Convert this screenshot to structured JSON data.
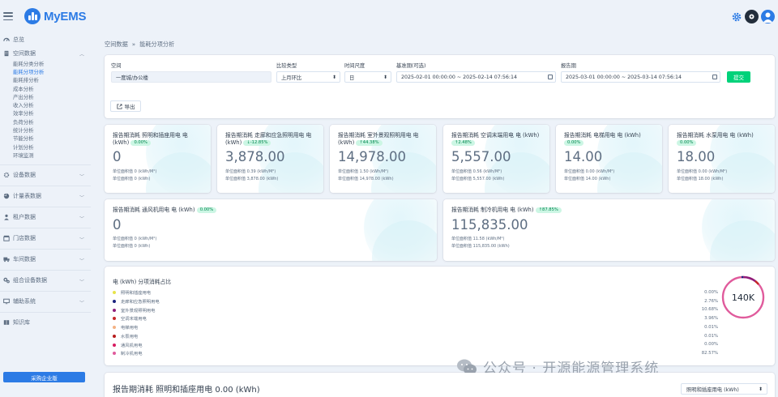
{
  "app": {
    "logo_text": "MyEMS"
  },
  "sidebar": {
    "overview": "总览",
    "space_data": "空间数据",
    "sub_items": [
      "能耗分类分析",
      "能耗分项分析",
      "能耗排分析",
      "成本分析",
      "产出分析",
      "收入分析",
      "效率分析",
      "负荷分析",
      "统计分析",
      "节能分析",
      "计划分析",
      "环境监测"
    ],
    "groups": [
      "设备数据",
      "计量表数据",
      "租户数据",
      "门店数据",
      "车间数据",
      "组合设备数据",
      "辅助系统",
      "知识库"
    ],
    "buy_button": "采购企业版"
  },
  "breadcrumb": {
    "parent": "空间数据",
    "separator": "»",
    "current": "能耗分项分析"
  },
  "filter": {
    "space_label": "空间",
    "space_value": "一度城/办公楼",
    "compare_label": "比较类型",
    "compare_value": "上月环比",
    "period_label": "时间尺度",
    "period_value": "日",
    "base_label": "基准期(可选)",
    "base_value": "2025-02-01 00:00:00 ~ 2025-02-14 07:56:14",
    "report_label": "报告期",
    "report_value": "2025-03-01 00:00:00 ~ 2025-03-14 07:56:14",
    "submit": "提交",
    "export": "导出"
  },
  "metrics_row1": [
    {
      "title": "报告期消耗 照明和插座用电 电 (kWh)",
      "badge": "0.00%",
      "value": "0",
      "sub1": "单位面积值 0 (kWh/M²)",
      "sub2": "单位面积值 0 (kWh)"
    },
    {
      "title": "报告期消耗 走廊和应急照明用电 电 (kWh)",
      "badge": "↓-12.85%",
      "value": "3,878.00",
      "sub1": "单位面积值 0.39 (kWh/M²)",
      "sub2": "单位面积值 3,878.00 (kWh)"
    },
    {
      "title": "报告期消耗 室外景观照明用电 电 (kWh)",
      "badge": "↑44.38%",
      "value": "14,978.00",
      "sub1": "单位面积值 1.50 (kWh/M²)",
      "sub2": "单位面积值 14,978.00 (kWh)"
    },
    {
      "title": "报告期消耗 空调末端用电 电 (kWh)",
      "badge": "↑2.48%",
      "value": "5,557.00",
      "sub1": "单位面积值 0.56 (kWh/M²)",
      "sub2": "单位面积值 5,557.00 (kWh)"
    },
    {
      "title": "报告期消耗 电梯用电 电 (kWh)",
      "badge": "0.00%",
      "value": "14.00",
      "sub1": "单位面积值 0.00 (kWh/M²)",
      "sub2": "单位面积值 14.00 (kWh)"
    },
    {
      "title": "报告期消耗 水泵用电 电 (kWh)",
      "badge": "0.00%",
      "value": "18.00",
      "sub1": "单位面积值 0.00 (kWh/M²)",
      "sub2": "单位面积值 18.00 (kWh)"
    }
  ],
  "metrics_row2": [
    {
      "title": "报告期消耗 通风机用电 电 (kWh)",
      "badge": "0.00%",
      "value": "0",
      "sub1": "单位面积值 0 (kWh/M²)",
      "sub2": "单位面积值 0 (kWh)"
    },
    {
      "title": "报告期消耗 制冷机用电 电 (kWh)",
      "badge": "↑87.85%",
      "value": "115,835.00",
      "sub1": "单位面积值 11.58 (kWh/M²)",
      "sub2": "单位面积值 115,835.00 (kWh)"
    }
  ],
  "pie": {
    "title": "电 (kWh) 分项消耗占比",
    "center_label": "140K",
    "items": [
      {
        "name": "照明和插座用电",
        "color": "#e7e34a",
        "pct": "0.00%"
      },
      {
        "name": "走廊和应急照明用电",
        "color": "#1a237e",
        "pct": "2.76%"
      },
      {
        "name": "室外景观照明用电",
        "color": "#8e1e7a",
        "pct": "10.68%"
      },
      {
        "name": "空调末端用电",
        "color": "#c62828",
        "pct": "3.96%"
      },
      {
        "name": "电梯用电",
        "color": "#f4b183",
        "pct": "0.01%"
      },
      {
        "name": "水泵用电",
        "color": "#b71c1c",
        "pct": "0.01%"
      },
      {
        "name": "通风机用电",
        "color": "#d81b60",
        "pct": "0.00%"
      },
      {
        "name": "制冷机用电",
        "color": "#e05b9c",
        "pct": "82.57%"
      }
    ]
  },
  "watermark": "公众号 · 开源能源管理系统",
  "bottom": {
    "title": "报告期消耗 照明和插座用电 0.00 (kWh)",
    "select_value": "照明和插座用电 (kWh)"
  }
}
